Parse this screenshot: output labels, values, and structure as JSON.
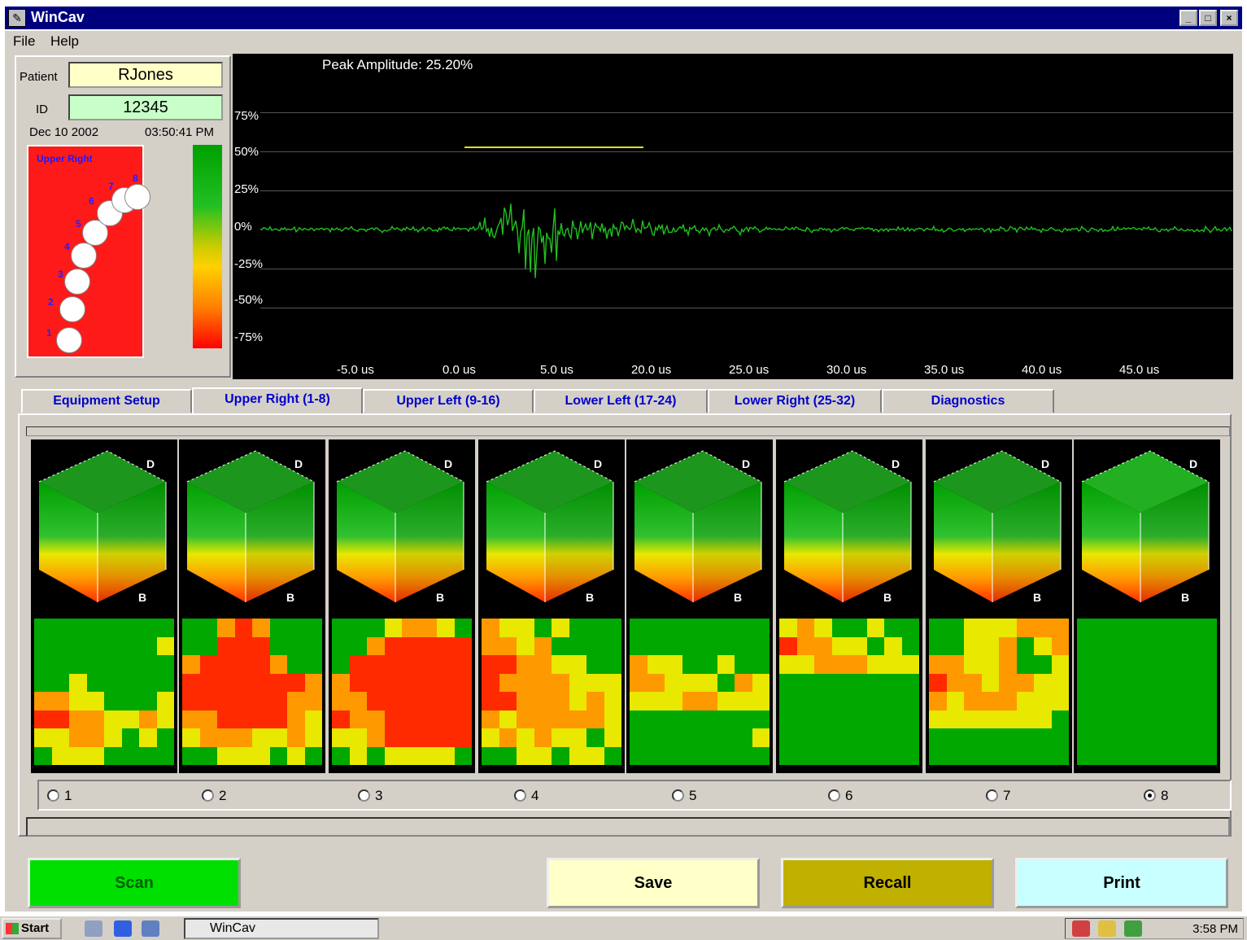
{
  "window": {
    "title": "WinCav",
    "minimize": "_",
    "maximize": "□",
    "close": "×"
  },
  "menu": [
    "File",
    "Help"
  ],
  "patient": {
    "name_label": "Patient",
    "name": "RJones",
    "id_label": "ID",
    "id": "12345",
    "date": "Dec 10 2002",
    "time": "03:50:41 PM"
  },
  "tooth_map": {
    "quadrant": "Upper Right",
    "numbers": [
      "1",
      "2",
      "3",
      "4",
      "5",
      "6",
      "7",
      "8"
    ]
  },
  "scope": {
    "peak_label": "Peak Amplitude: 25.20%",
    "y_labels": [
      "75%",
      "50%",
      "25%",
      "0%",
      "-25%",
      "-50%",
      "-75%"
    ],
    "x_labels": [
      "-5.0 us",
      "0.0 us",
      "5.0 us",
      "20.0 us",
      "25.0 us",
      "30.0 us",
      "35.0 us",
      "40.0 us",
      "45.0 us"
    ],
    "trace_color": "#20c020",
    "threshold_color": "#e0e020"
  },
  "tabs": [
    "Equipment Setup",
    "Upper Right (1-8)",
    "Upper Left (9-16)",
    "Lower Left (17-24)",
    "Lower Right (25-32)",
    "Diagnostics"
  ],
  "active_tab": 1,
  "cube_axis_labels": {
    "top": "D",
    "bottom": "B"
  },
  "tooth_selector": [
    "1",
    "2",
    "3",
    "4",
    "5",
    "6",
    "7",
    "8"
  ],
  "selected_tooth": "8",
  "buttons": {
    "scan": "Scan",
    "save": "Save",
    "recall": "Recall",
    "print": "Print"
  },
  "button_colors": {
    "scan": "#00e000",
    "save": "#ffffc8",
    "recall": "#c0b000",
    "print": "#c8ffff"
  },
  "taskbar": {
    "start": "Start",
    "task": "WinCav",
    "clock": "3:58 PM"
  }
}
